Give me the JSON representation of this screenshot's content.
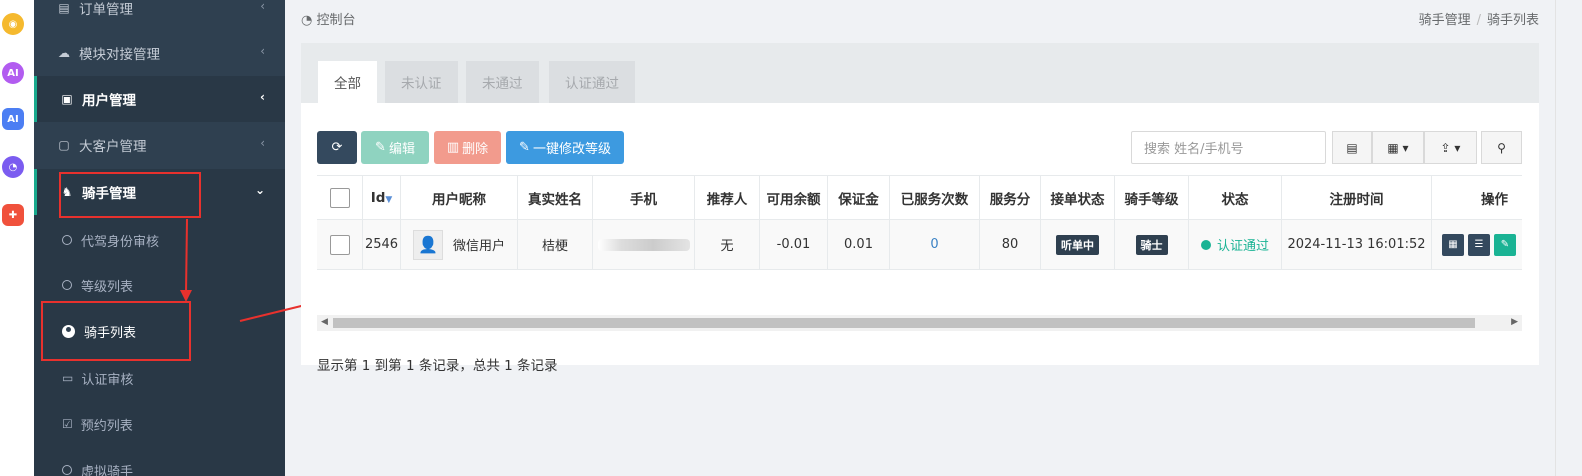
{
  "sidebar": {
    "items": [
      {
        "label": "订单管理",
        "icon": "list-icon"
      },
      {
        "label": "模块对接管理",
        "icon": "cloud-icon"
      },
      {
        "label": "用户管理",
        "icon": "user-card-icon"
      },
      {
        "label": "大客户管理",
        "icon": "contact-icon"
      },
      {
        "label": "骑手管理",
        "icon": "rider-icon"
      }
    ],
    "sub_items": [
      {
        "label": "代驾身份审核"
      },
      {
        "label": "等级列表"
      },
      {
        "label": "骑手列表"
      },
      {
        "label": "认证审核"
      },
      {
        "label": "预约列表"
      },
      {
        "label": "虚拟骑手"
      }
    ]
  },
  "breadcrumb": {
    "home": "控制台",
    "path": [
      "骑手管理",
      "骑手列表"
    ],
    "separator": "/"
  },
  "tabs": [
    "全部",
    "未认证",
    "未通过",
    "认证通过"
  ],
  "toolbar": {
    "edit": "编辑",
    "delete": "删除",
    "level": "一键修改等级",
    "search_placeholder": "搜索 姓名/手机号"
  },
  "table": {
    "headers": [
      "Id",
      "用户昵称",
      "真实姓名",
      "手机",
      "推荐人",
      "可用余额",
      "保证金",
      "已服务次数",
      "服务分",
      "接单状态",
      "骑手等级",
      "状态",
      "注册时间",
      "操作"
    ],
    "rows": [
      {
        "id": "2546",
        "nickname": "微信用户",
        "real_name": "桔梗",
        "referrer": "无",
        "balance": "-0.01",
        "deposit": "0.01",
        "served": "0",
        "score": "80",
        "order_status": "听单中",
        "level": "骑士",
        "status": "认证通过",
        "registered": "2024-11-13 16:01:52"
      }
    ]
  },
  "footer": "显示第 1 到第 1 条记录，总共 1 条记录",
  "colors": {
    "sidebar": "#2f4050",
    "accent": "#1ab394",
    "refresh": "#34495e",
    "edit": "#8fd3c0",
    "delete": "#f29b8d",
    "level": "#3d9ae0",
    "annotation": "#e8312d"
  }
}
